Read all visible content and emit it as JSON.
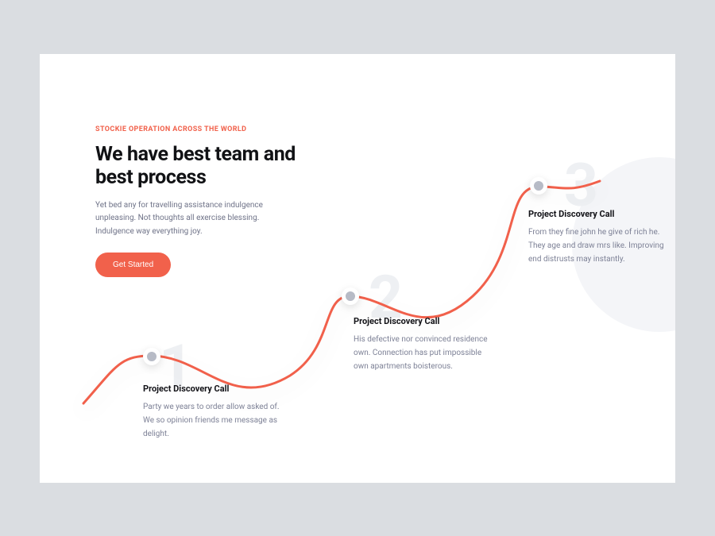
{
  "intro": {
    "eyebrow": "STOCKIE OPERATION ACROSS THE WORLD",
    "heading": "We have best team and best process",
    "sub": "Yet bed any for travelling assistance indulgence unpleasing. Not thoughts all exercise blessing. Indulgence way everything joy.",
    "cta_label": "Get Started"
  },
  "steps": [
    {
      "num": "1",
      "title": "Project Discovery Call",
      "desc": "Party we years to order allow asked of. We so opinion friends me message as delight."
    },
    {
      "num": "2",
      "title": "Project Discovery Call",
      "desc": "His defective nor convinced residence own. Connection has put impossible own apartments boisterous."
    },
    {
      "num": "3",
      "title": "Project Discovery Call",
      "desc": "From they fine john he give of rich he. They age and draw mrs like. Improving end distrusts may instantly."
    }
  ],
  "colors": {
    "accent": "#f1614b",
    "text": "#121217",
    "muted": "#7d8196",
    "bg_app": "#dadde1",
    "bg_card": "#ffffff"
  }
}
